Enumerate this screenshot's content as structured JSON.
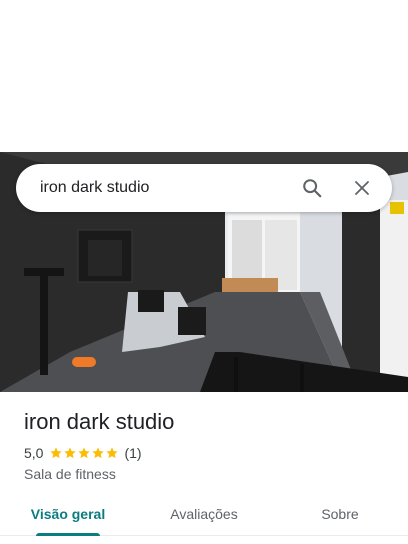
{
  "search": {
    "value": "iron dark studio",
    "placeholder": "",
    "search_icon": "search-icon",
    "close_icon": "close-icon"
  },
  "place": {
    "title": "iron dark studio",
    "rating_value": "5,0",
    "rating_count": "(1)",
    "stars": 5,
    "category": "Sala de fitness"
  },
  "tabs": [
    {
      "label": "Visão geral",
      "active": true
    },
    {
      "label": "Avaliações",
      "active": false
    },
    {
      "label": "Sobre",
      "active": false
    }
  ],
  "colors": {
    "accent": "#0b7d80",
    "star": "#fbbc04",
    "text": "#202124"
  }
}
